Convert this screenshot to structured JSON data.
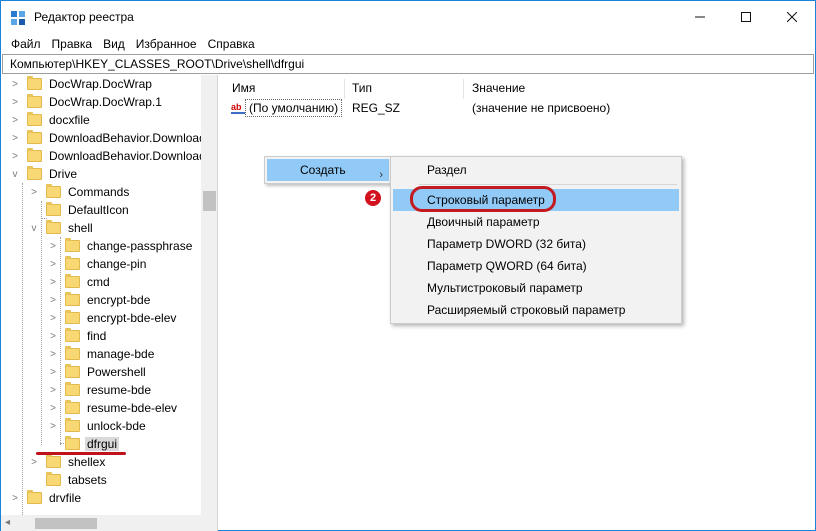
{
  "window": {
    "title": "Редактор реестра",
    "minimize": "—",
    "maximize": "☐",
    "close": "✕",
    "border_color": "#1883d7"
  },
  "menu": [
    "Файл",
    "Правка",
    "Вид",
    "Избранное",
    "Справка"
  ],
  "address": "Компьютер\\HKEY_CLASSES_ROOT\\Drive\\shell\\dfrgui",
  "tree": {
    "items": [
      {
        "label": "DocWrap.DocWrap"
      },
      {
        "label": "DocWrap.DocWrap.1"
      },
      {
        "label": "docxfile"
      },
      {
        "label": "DownloadBehavior.Download"
      },
      {
        "label": "DownloadBehavior.Download"
      },
      {
        "label": "Drive"
      },
      {
        "label": "Commands"
      },
      {
        "label": "DefaultIcon"
      },
      {
        "label": "shell"
      },
      {
        "label": "change-passphrase"
      },
      {
        "label": "change-pin"
      },
      {
        "label": "cmd"
      },
      {
        "label": "encrypt-bde"
      },
      {
        "label": "encrypt-bde-elev"
      },
      {
        "label": "find"
      },
      {
        "label": "manage-bde"
      },
      {
        "label": "Powershell"
      },
      {
        "label": "resume-bde"
      },
      {
        "label": "resume-bde-elev"
      },
      {
        "label": "unlock-bde"
      },
      {
        "label": "dfrgui"
      },
      {
        "label": "shellex"
      },
      {
        "label": "tabsets"
      },
      {
        "label": "drvfile"
      }
    ]
  },
  "list": {
    "headers": {
      "name": "Имя",
      "type": "Тип",
      "value": "Значение"
    },
    "rows": [
      {
        "icon": "ab",
        "name": "(По умолчанию)",
        "type": "REG_SZ",
        "value": "(значение не присвоено)"
      }
    ]
  },
  "context_menu": {
    "create_label": "Создать",
    "create_arrow": "›",
    "submenu": [
      "Раздел",
      "Строковый параметр",
      "Двоичный параметр",
      "Параметр DWORD (32 бита)",
      "Параметр QWORD (64 бита)",
      "Мультистроковый параметр",
      "Расширяемый строковый параметр"
    ],
    "highlight_color": "#91c9f7"
  },
  "annotation": {
    "step": "2",
    "color": "#c21a1e"
  }
}
